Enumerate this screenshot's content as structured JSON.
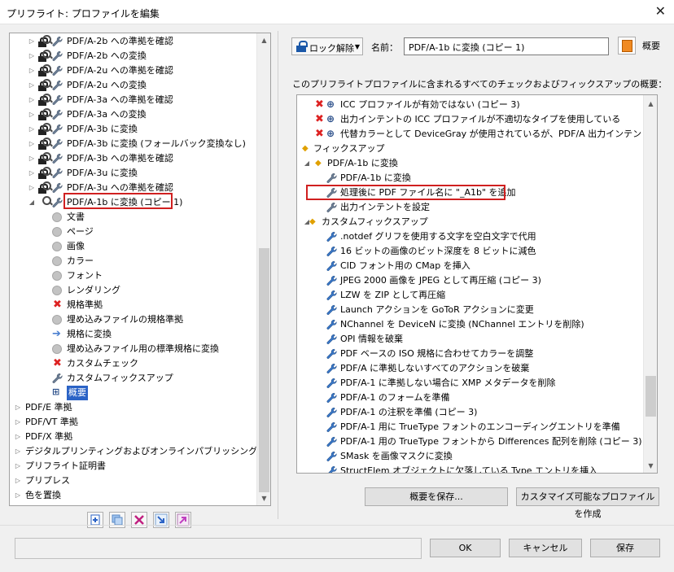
{
  "window": {
    "title": "プリフライト: プロファイルを編集",
    "close_glyph": "✕"
  },
  "left_tree": {
    "profile_rows": [
      "PDF/A-2b への準拠を確認",
      "PDF/A-2b への変換",
      "PDF/A-2u への準拠を確認",
      "PDF/A-2u への変換",
      "PDF/A-3a への準拠を確認",
      "PDF/A-3a への変換",
      "PDF/A-3b に変換",
      "PDF/A-3b に変換 (フォールバック変換なし)",
      "PDF/A-3b への準拠を確認",
      "PDF/A-3u に変換",
      "PDF/A-3u への準拠を確認"
    ],
    "selected_profile": "PDF/A-1b に変換 (コピー 1)",
    "sub_items": [
      {
        "label": "文書",
        "icon": "circle"
      },
      {
        "label": "ページ",
        "icon": "circle"
      },
      {
        "label": "画像",
        "icon": "circle"
      },
      {
        "label": "カラー",
        "icon": "circle"
      },
      {
        "label": "フォント",
        "icon": "circle"
      },
      {
        "label": "レンダリング",
        "icon": "circle"
      },
      {
        "label": "規格準拠",
        "icon": "x"
      },
      {
        "label": "埋め込みファイルの規格準拠",
        "icon": "circle"
      },
      {
        "label": "規格に変換",
        "icon": "arrow"
      },
      {
        "label": "埋め込みファイル用の標準規格に変換",
        "icon": "circle"
      },
      {
        "label": "カスタムチェック",
        "icon": "x"
      },
      {
        "label": "カスタムフィックスアップ",
        "icon": "wrench"
      },
      {
        "label": "概要",
        "icon": "tree",
        "selected": true
      }
    ],
    "groups": [
      "PDF/E 準拠",
      "PDF/VT 準拠",
      "PDF/X 準拠",
      "デジタルプリンティングおよびオンラインパブリッシング",
      "プリフライト証明書",
      "プリプレス",
      "色を置換"
    ]
  },
  "header": {
    "lock_label": "ロック解除",
    "name_label": "名前：",
    "name_value": "PDF/A-1b に変換 (コピー 1)",
    "summary_label": "概要"
  },
  "right": {
    "heading": "このプリフライトプロファイルに含まれるすべてのチェックおよびフィックスアップの概要：",
    "checks": [
      "ICC プロファイルが有効ではない (コピー 3)",
      "出力インテントの ICC プロファイルが不適切なタイプを使用している",
      "代替カラーとして DeviceGray が使用されているが、PDF/A 出力インテントが CMYK、RG"
    ],
    "fixups_label": "フィックスアップ",
    "fixup_group": "PDF/A-1b に変換",
    "fixup_items": [
      "PDF/A-1b に変換",
      "処理後に PDF ファイル名に \"_A1b\" を追加",
      "出力インテントを設定"
    ],
    "custom_fixups_label": "カスタムフィックスアップ",
    "custom_items": [
      ".notdef グリフを使用する文字を空白文字で代用",
      "16 ビットの画像のビット深度を 8 ビットに減色",
      "CID フォント用の CMap を挿入",
      "JPEG 2000 画像を JPEG として再圧縮 (コピー 3)",
      "LZW を ZIP として再圧縮",
      "Launch アクションを GoToR アクションに変更",
      "NChannel を DeviceN に変換 (NChannel エントリを削除)",
      "OPI 情報を破棄",
      "PDF ベースの ISO 規格に合わせてカラーを調整",
      "PDF/A に準拠しないすべてのアクションを破棄",
      "PDF/A-1 に準拠しない場合に XMP メタデータを削除",
      "PDF/A-1 のフォームを準備",
      "PDF/A-1 の注釈を準備 (コピー 3)",
      "PDF/A-1 用に TrueType フォントのエンコーディングエントリを準備",
      "PDF/A-1 用の TrueType フォントから Differences 配列を削除 (コピー 3)",
      "SMask を画像マスクに変換",
      "StructElem オブジェクトに欠落している Type エントリを挿入"
    ]
  },
  "buttons": {
    "save_summary": "概要を保存...",
    "create_custom": "カスタマイズ可能なプロファイルを作成",
    "ok": "OK",
    "cancel": "キャンセル",
    "save": "保存"
  },
  "colors": {
    "selection": "#2b63c6",
    "highlight_box": "#d02020",
    "error": "#d22222"
  }
}
